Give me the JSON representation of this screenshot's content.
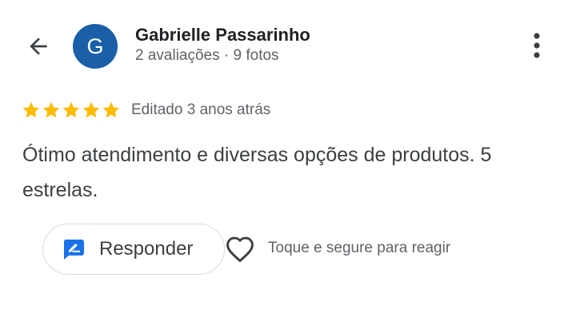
{
  "header": {
    "back_icon": "arrow-back-icon",
    "avatar_letter": "G",
    "avatar_color": "#1a5fa8",
    "author_name": "Gabrielle Passarinho",
    "author_meta": "2 avaliações · 9 fotos",
    "menu_icon": "more-vert-icon"
  },
  "review": {
    "rating": 5,
    "rating_max": 5,
    "star_color": "#fbbc04",
    "edited_label": "Editado 3 anos atrás",
    "text": "Ótimo atendimento e diversas opções de produtos. 5 estrelas."
  },
  "actions": {
    "reply_icon": "rate-review-icon",
    "reply_icon_color": "#1a73e8",
    "reply_label": "Responder",
    "react_icon": "heart-outline-icon",
    "react_hint": "Toque e segure para reagir"
  }
}
